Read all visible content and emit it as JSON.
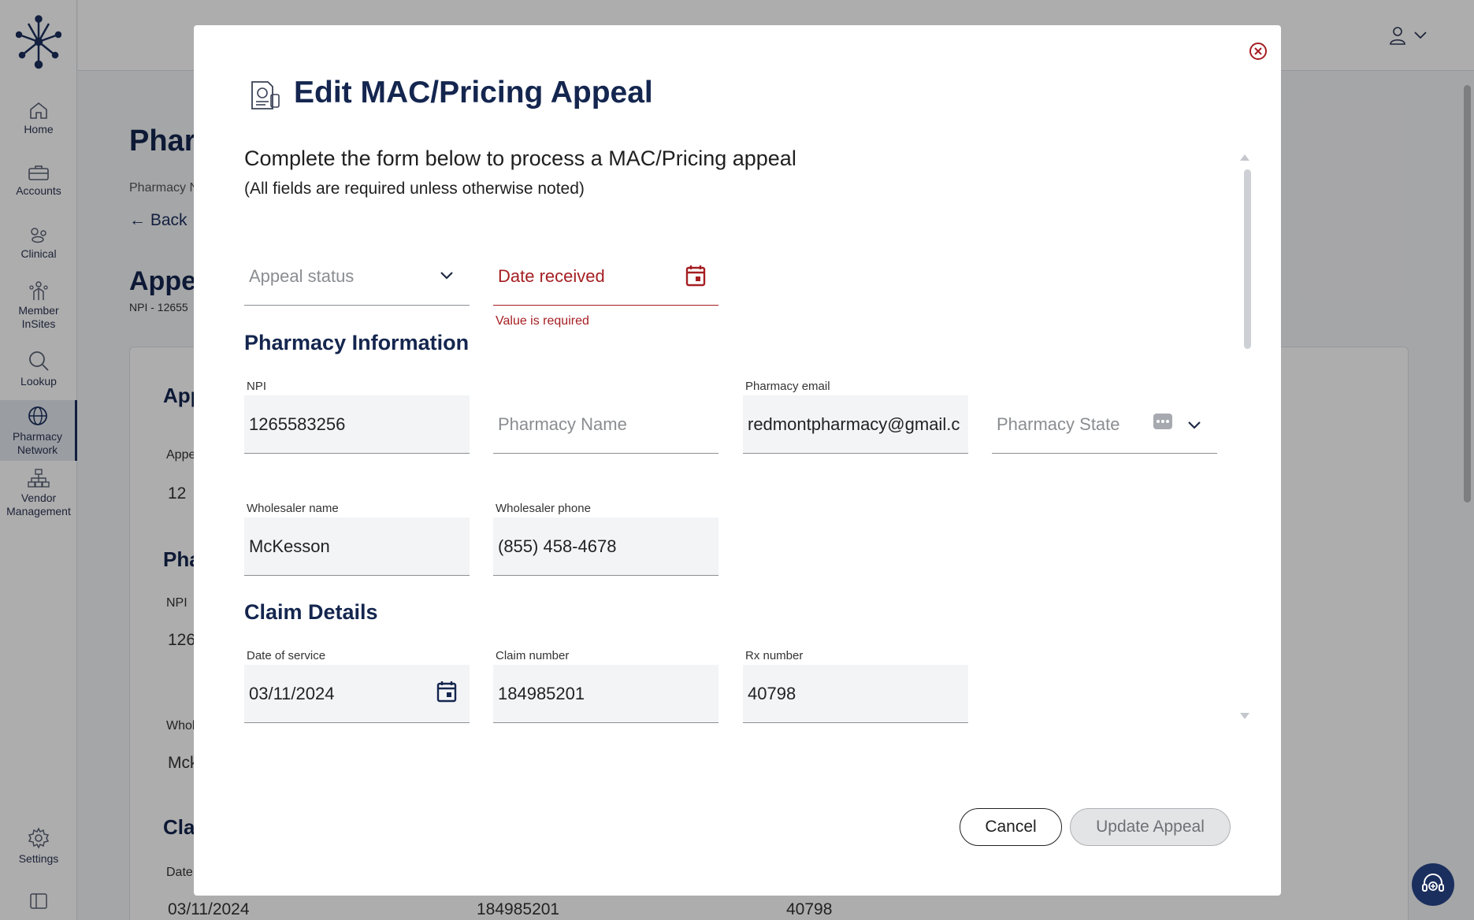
{
  "nav": {
    "items": [
      {
        "label": "Home",
        "icon": "home-icon"
      },
      {
        "label": "Accounts",
        "icon": "briefcase-icon"
      },
      {
        "label": "Clinical",
        "icon": "clinical-icon"
      },
      {
        "label": "Member\nInSites",
        "label1": "Member",
        "label2": "InSites",
        "icon": "member-icon"
      },
      {
        "label": "Lookup",
        "icon": "search-icon"
      },
      {
        "label": "Pharmacy",
        "label2": "Network",
        "icon": "globe-icon"
      },
      {
        "label": "Vendor",
        "label2": "Management",
        "icon": "hierarchy-icon"
      },
      {
        "label": "Settings",
        "icon": "gear-icon"
      }
    ]
  },
  "background": {
    "title": "Phar",
    "breadcrumb": "Pharmacy N",
    "back_label": "Back",
    "subtitle": "Appea",
    "npi_line": "NPI - 12655",
    "card": {
      "heading1": "App",
      "appeal_label": "Appe",
      "appeal_value": "12",
      "heading2": "Pha",
      "npi_label": "NPI",
      "npi_value": "126",
      "wholesaler_label": "Whol",
      "wholesaler_value": "Mck",
      "heading3": "Cla",
      "date_label": "Date",
      "date_value": "03/11/2024",
      "claim_value": "184985201",
      "rx_value": "40798"
    }
  },
  "modal": {
    "title": "Edit MAC/Pricing Appeal",
    "intro": "Complete the form below to process a MAC/Pricing appeal",
    "note": "(All fields are required unless otherwise noted)",
    "appeal_status": {
      "placeholder": "Appeal status"
    },
    "date_received": {
      "placeholder": "Date received",
      "error": "Value is required"
    },
    "pharmacy_section": "Pharmacy Information",
    "npi": {
      "label": "NPI",
      "value": "1265583256"
    },
    "pharmacy_name": {
      "placeholder": "Pharmacy Name"
    },
    "pharmacy_email": {
      "label": "Pharmacy email",
      "value": "redmontpharmacy@gmail.com"
    },
    "pharmacy_state": {
      "placeholder": "Pharmacy State"
    },
    "wholesaler_name": {
      "label": "Wholesaler name",
      "value": "McKesson"
    },
    "wholesaler_phone": {
      "label": "Wholesaler phone",
      "value": "(855) 458-4678"
    },
    "claim_section": "Claim Details",
    "date_of_service": {
      "label": "Date of service",
      "value": "03/11/2024"
    },
    "claim_number": {
      "label": "Claim number",
      "value": "184985201"
    },
    "rx_number": {
      "label": "Rx number",
      "value": "40798"
    },
    "cancel_label": "Cancel",
    "update_label": "Update Appeal"
  },
  "colors": {
    "brand_navy": "#14264f",
    "error_red": "#a51e22",
    "overlay": "rgba(0,0,0,0.32)"
  }
}
